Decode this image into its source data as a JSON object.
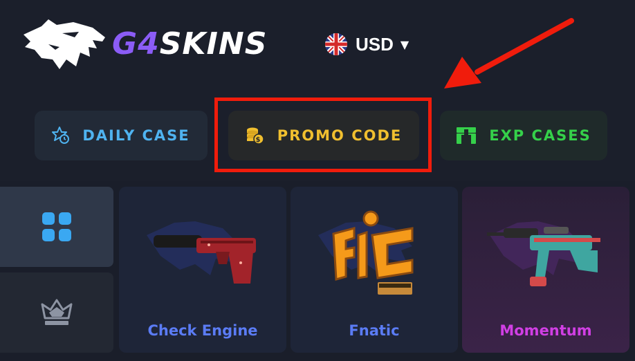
{
  "brand": {
    "logo_prefix": "G4",
    "logo_suffix": "SKINS",
    "accent": "#8b5cf6"
  },
  "currency": {
    "value": "USD",
    "flag": "uk-flag-icon"
  },
  "actions": {
    "daily_case": "DAILY CASE",
    "promo_code": "PROMO CODE",
    "exp_cases": "EXP CASES"
  },
  "sidebar": {
    "items": [
      {
        "icon": "grid-icon"
      },
      {
        "icon": "crown-icon"
      }
    ]
  },
  "cases": [
    {
      "name": "Check Engine",
      "color": "#5b7cf5"
    },
    {
      "name": "Fnatic",
      "color": "#5b7cf5"
    },
    {
      "name": "Momentum",
      "color": "#d13fe4"
    }
  ],
  "annotation": {
    "highlight_color": "#f01c0c"
  }
}
